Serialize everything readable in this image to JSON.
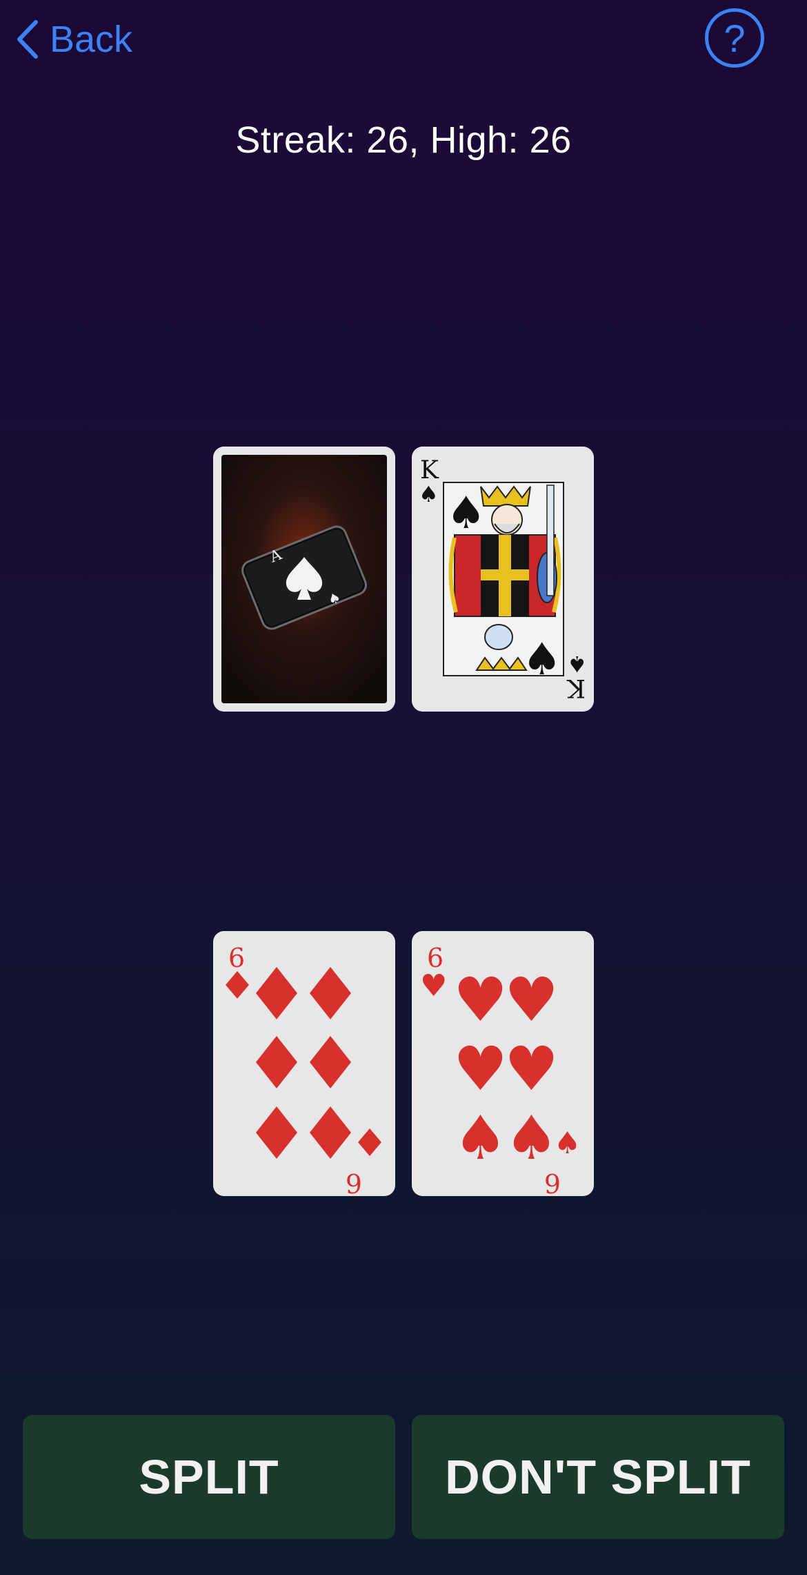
{
  "nav": {
    "back_label": "Back",
    "help_symbol": "?"
  },
  "streak": {
    "text": "Streak: 26, High: 26"
  },
  "dealer": {
    "cards": [
      {
        "state": "face-down",
        "back_design": "ace-of-spades-art"
      },
      {
        "rank": "K",
        "suit": "spades",
        "symbol": "♠"
      }
    ]
  },
  "player": {
    "cards": [
      {
        "rank": "6",
        "suit": "diamonds",
        "symbol": "♦"
      },
      {
        "rank": "6",
        "suit": "hearts",
        "symbol": "♥"
      }
    ]
  },
  "actions": {
    "split_label": "SPLIT",
    "dont_split_label": "DON'T SPLIT"
  },
  "colors": {
    "accent": "#3b82f6",
    "button_bg": "#1a3a2c",
    "card_red": "#d8302c",
    "card_face": "#e6e7e6"
  }
}
